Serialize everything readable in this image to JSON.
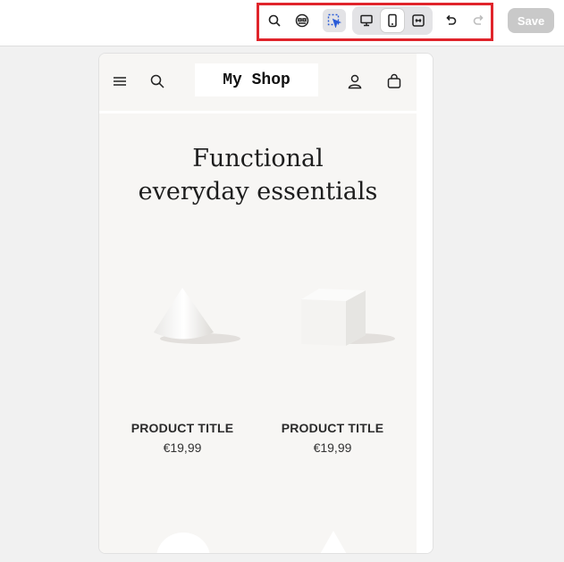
{
  "toolbar": {
    "buttons": [
      {
        "name": "search-icon",
        "label": "Search"
      },
      {
        "name": "sections-icon",
        "label": "Sections"
      },
      {
        "name": "select-icon",
        "label": "Select"
      },
      {
        "name": "desktop-icon",
        "label": "Desktop"
      },
      {
        "name": "mobile-icon",
        "label": "Mobile"
      },
      {
        "name": "fullwidth-icon",
        "label": "Full width"
      },
      {
        "name": "undo-icon",
        "label": "Undo"
      },
      {
        "name": "redo-icon",
        "label": "Redo"
      }
    ],
    "save_label": "Save",
    "highlight_color": "#e0242b"
  },
  "store": {
    "logo_text": "My Shop",
    "hero_title_line1": "Functional",
    "hero_title_line2": "everyday essentials",
    "products": [
      {
        "title": "PRODUCT TITLE",
        "price": "€19,99",
        "shape": "cone"
      },
      {
        "title": "PRODUCT TITLE",
        "price": "€19,99",
        "shape": "cube"
      }
    ]
  },
  "colors": {
    "preview_bg": "#f7f6f4",
    "canvas_bg": "#f1f1f1",
    "save_disabled": "#c9c9c9"
  }
}
